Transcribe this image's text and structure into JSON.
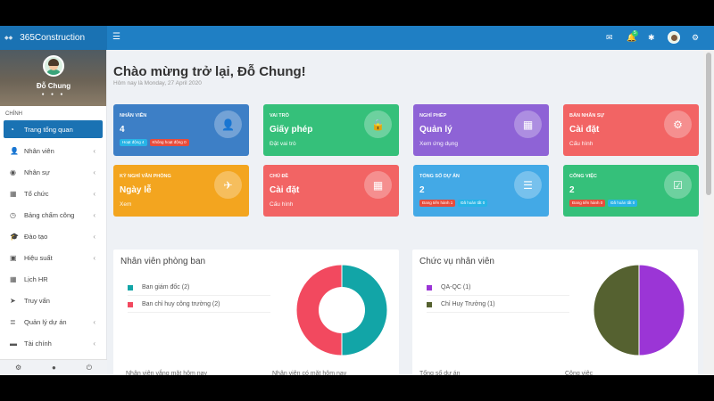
{
  "brand": {
    "name": "365Construction"
  },
  "topbar": {
    "notification_count": "5"
  },
  "user": {
    "name": "Đỗ Chung"
  },
  "sidebar": {
    "section": "CHÍNH",
    "items": [
      {
        "label": "Trang tổng quan",
        "icon": "dashboard-icon"
      },
      {
        "label": "Nhân viên",
        "icon": "user-icon"
      },
      {
        "label": "Nhân sự",
        "icon": "globe-icon"
      },
      {
        "label": "Tổ chức",
        "icon": "building-icon"
      },
      {
        "label": "Bảng chấm công",
        "icon": "clock-icon"
      },
      {
        "label": "Đào tạo",
        "icon": "graduation-cap-icon"
      },
      {
        "label": "Hiệu suất",
        "icon": "cube-icon"
      },
      {
        "label": "Lịch HR",
        "icon": "calendar-icon"
      },
      {
        "label": "Truy vấn",
        "icon": "rocket-icon"
      },
      {
        "label": "Quản lý dự án",
        "icon": "list-icon"
      },
      {
        "label": "Tài chính",
        "icon": "money-icon"
      }
    ]
  },
  "header": {
    "welcome": "Chào mừng trở lại, Đỗ Chung!",
    "subtitle": "Hôm nay là Monday, 27 April 2020"
  },
  "cards": [
    {
      "label": "NHÂN VIÊN",
      "value": "4",
      "tags": [
        {
          "text": "Hoạt động 4",
          "color": "#27b4e6"
        },
        {
          "text": "Không hoạt động 0",
          "color": "#e74c3c"
        }
      ],
      "color": "#3d7fc6",
      "icon": "user-icon"
    },
    {
      "label": "VAI TRÒ",
      "value": "Giấy phép",
      "sub": "Đặt vai trò",
      "color": "#35c07a",
      "icon": "lock-icon"
    },
    {
      "label": "NGHỈ PHÉP",
      "value": "Quản lý",
      "sub": "Xem ứng dụng",
      "color": "#8e63d6",
      "icon": "calendar-icon"
    },
    {
      "label": "BẢN NHÂN SỰ",
      "value": "Cài đặt",
      "sub": "Cấu hình",
      "color": "#f26464",
      "icon": "gear-icon"
    },
    {
      "label": "KỲ NGHỈ VĂN PHÒNG",
      "value": "Ngày lễ",
      "sub": "Xem",
      "color": "#f3a51f",
      "icon": "plane-icon"
    },
    {
      "label": "CHỦ ĐỀ",
      "value": "Cài đặt",
      "sub": "Cấu hình",
      "color": "#f26464",
      "icon": "table-icon"
    },
    {
      "label": "TỔNG SỐ DỰ ÁN",
      "value": "2",
      "tags": [
        {
          "text": "Đang tiến hành 1",
          "color": "#e74c3c"
        },
        {
          "text": "Đã hoàn tất 0",
          "color": "#27b4e6"
        }
      ],
      "color": "#43a9e6",
      "icon": "server-icon"
    },
    {
      "label": "CÔNG VIỆC",
      "value": "2",
      "tags": [
        {
          "text": "Đang tiến hành 0",
          "color": "#e74c3c"
        },
        {
          "text": "Đã hoàn tất 0",
          "color": "#27b4e6"
        }
      ],
      "color": "#35c07a",
      "icon": "calendar-check-icon"
    }
  ],
  "panels": {
    "dept": {
      "title": "Nhân viên phòng ban"
    },
    "pos": {
      "title": "Chức vụ nhân viên"
    }
  },
  "chart_data": [
    {
      "type": "pie",
      "title": "Nhân viên phòng ban",
      "donut": true,
      "categories": [
        "Ban giám đốc",
        "Ban chỉ huy công trường"
      ],
      "labels": [
        "Ban giám đốc (2)",
        "Ban chỉ huy công trường (2)"
      ],
      "values": [
        2,
        2
      ],
      "colors": [
        "#12a5a7",
        "#f2495f"
      ]
    },
    {
      "type": "pie",
      "title": "Chức vụ nhân viên",
      "categories": [
        "QA-QC",
        "Chỉ Huy Trưởng"
      ],
      "labels": [
        "QA-QC (1)",
        "Chỉ Huy Trưởng (1)"
      ],
      "values": [
        1,
        1
      ],
      "colors": [
        "#9b35d6",
        "#556130"
      ]
    }
  ],
  "bottom": {
    "labels": [
      "Nhân viên vắng mặt hôm nay",
      "Nhân viên có mặt hôm nay",
      "Tổng số dự án",
      "Công việc"
    ]
  }
}
